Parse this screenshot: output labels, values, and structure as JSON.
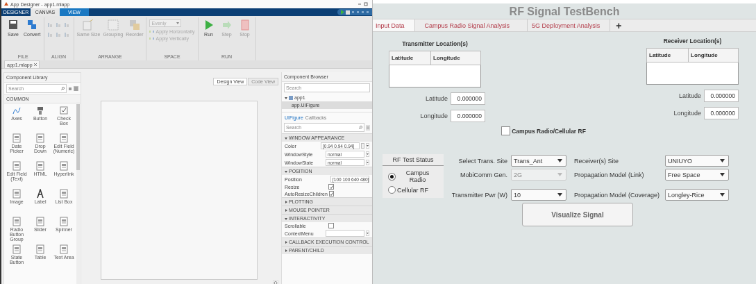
{
  "designer": {
    "title": "App Designer - app1.mlapp",
    "tabs": [
      {
        "label": "DESIGNER",
        "selected": false
      },
      {
        "label": "CANVAS",
        "selected": true
      },
      {
        "label": "VIEW",
        "selected": false
      }
    ],
    "ribbon": [
      {
        "label": "FILE",
        "items": [
          {
            "kind": "large",
            "label": "Save",
            "disabled": false
          },
          {
            "kind": "large",
            "label": "Convert",
            "disabled": false
          }
        ]
      },
      {
        "label": "ALIGN",
        "items": [
          {
            "kind": "grid",
            "disabled": true
          }
        ]
      },
      {
        "label": "ARRANGE",
        "items": [
          {
            "kind": "large",
            "label": "Same Size",
            "disabled": true
          },
          {
            "kind": "large",
            "label": "Grouping",
            "disabled": true
          },
          {
            "kind": "large",
            "label": "Reorder",
            "disabled": true
          }
        ]
      },
      {
        "label": "SPACE",
        "items": [
          {
            "kind": "dropdown",
            "label": "Evenly",
            "disabled": true
          },
          {
            "kind": "small",
            "label": "Apply Horizontally",
            "disabled": true
          },
          {
            "kind": "small",
            "label": "Apply Vertically",
            "disabled": true
          }
        ]
      },
      {
        "label": "RUN",
        "items": [
          {
            "kind": "large",
            "label": "Run",
            "disabled": false
          },
          {
            "kind": "large",
            "label": "Step",
            "disabled": true
          },
          {
            "kind": "large",
            "label": "Stop",
            "disabled": true
          }
        ]
      }
    ],
    "file_tab": "app1.mlapp",
    "library": {
      "title": "Component Library",
      "search_placeholder": "Search",
      "section": "COMMON",
      "components": [
        "Axes",
        "Button",
        "Check Box",
        "Date Picker",
        "Drop Down",
        "Edit Field (Numeric)",
        "Edit Field (Text)",
        "HTML",
        "Hyperlink",
        "Image",
        "Label",
        "List Box",
        "Radio Button Group",
        "Slider",
        "Spinner",
        "State Button",
        "Table",
        "Text Area"
      ]
    },
    "view_buttons": [
      {
        "label": "Design View",
        "selected": true
      },
      {
        "label": "Code View",
        "selected": false
      }
    ],
    "browser": {
      "title": "Component Browser",
      "search_placeholder": "Search",
      "tree": [
        {
          "label": "app1",
          "expanded": true,
          "children": [
            {
              "label": "app.UIFigure",
              "selected": true
            }
          ]
        }
      ],
      "tabs": [
        {
          "label": "UIFigure",
          "selected": true
        },
        {
          "label": "Callbacks",
          "selected": false
        }
      ],
      "property_search_placeholder": "Search",
      "sections": [
        {
          "title": "WINDOW APPEARANCE",
          "expanded": true,
          "properties": [
            {
              "label": "Color",
              "kind": "color",
              "value": "[0.94 0.94 0.94]"
            },
            {
              "label": "WindowStyle",
              "kind": "dropdown",
              "value": "normal"
            },
            {
              "label": "WindowState",
              "kind": "dropdown",
              "value": "normal"
            }
          ]
        },
        {
          "title": "POSITION",
          "expanded": true,
          "properties": [
            {
              "label": "Position",
              "kind": "text",
              "value": "[100 100 640 480]"
            },
            {
              "label": "Resize",
              "kind": "checkbox",
              "checked": true
            },
            {
              "label": "AutoResizeChildren",
              "kind": "checkbox",
              "checked": true
            }
          ]
        },
        {
          "title": "PLOTTING",
          "expanded": false
        },
        {
          "title": "MOUSE POINTER",
          "expanded": false
        },
        {
          "title": "INTERACTIVITY",
          "expanded": true,
          "properties": [
            {
              "label": "Scrollable",
              "kind": "checkbox",
              "checked": false
            },
            {
              "label": "ContextMenu",
              "kind": "dropdown"
            }
          ]
        },
        {
          "title": "CALLBACK EXECUTION CONTROL",
          "expanded": false
        },
        {
          "title": "PARENT/CHILD",
          "expanded": false
        }
      ]
    }
  },
  "app": {
    "title": "RF Signal TestBench",
    "tabs": [
      {
        "label": "Input Data",
        "selected": true
      },
      {
        "label": "Campus Radio Signal Analysis",
        "selected": false
      },
      {
        "label": "5G Deployment Analysis",
        "selected": false
      }
    ],
    "add_tab": "+",
    "transmitter": {
      "title": "Transmitter Location(s)",
      "columns": [
        "Latitude",
        "Longitude"
      ],
      "fields": [
        {
          "label": "Latitude",
          "value": "0.000000"
        },
        {
          "label": "Longitude",
          "value": "0.000000"
        }
      ]
    },
    "receiver": {
      "title": "Receiver Location(s)",
      "columns": [
        "Latitude",
        "Longitude"
      ],
      "fields": [
        {
          "label": "Latitude",
          "value": "0.000000"
        },
        {
          "label": "Longitude",
          "value": "0.000000"
        }
      ]
    },
    "checkbox": {
      "label": "Campus Radio/Cellular RF",
      "checked": false
    },
    "test_status": {
      "title": "RF Test Status",
      "options": [
        {
          "label": "Campus Radio",
          "selected": true
        },
        {
          "label": "Cellular RF",
          "selected": false
        }
      ]
    },
    "dropdowns": [
      {
        "label": "Select Trans. Site",
        "value": "Trans_Ant",
        "disabled": false
      },
      {
        "label": "Receiver(s) Site",
        "value": "UNIUYO",
        "disabled": false
      },
      {
        "label": "MobiComm Gen.",
        "value": "2G",
        "disabled": true
      },
      {
        "label": "Propagation Model (Link)",
        "value": "Free Space",
        "disabled": false
      },
      {
        "label": "Transmitter Pwr (W)",
        "value": "10",
        "disabled": false
      },
      {
        "label": "Propagation Model (Coverage)",
        "value": "Longley-Rice",
        "disabled": false
      }
    ],
    "button": "Visualize Signal"
  }
}
